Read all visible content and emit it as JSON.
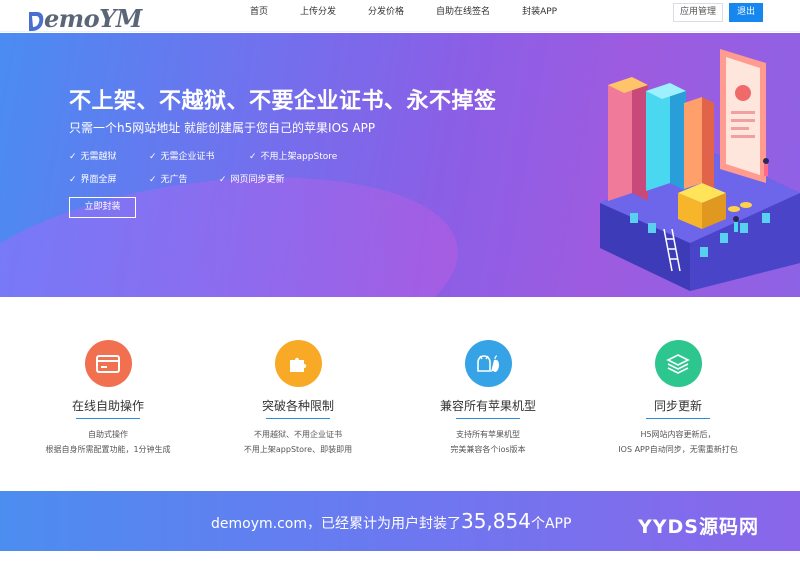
{
  "header": {
    "logo_text": "emoYM",
    "nav": [
      "首页",
      "上传分发",
      "分发价格",
      "自助在线签名",
      "封装APP"
    ],
    "manage_label": "应用管理",
    "logout_label": "退出"
  },
  "hero": {
    "title": "不上架、不越狱、不要企业证书、永不掉签",
    "subtitle": "只需一个h5网站地址 就能创建属于您自己的苹果IOS APP",
    "features": [
      "无需越狱",
      "无需企业证书",
      "不用上架appStore",
      "界面全屏",
      "无广告",
      "网页同步更新"
    ],
    "check_glyph": "✓",
    "button_label": "立即封装"
  },
  "cards": [
    {
      "icon": "card-icon",
      "title": "在线自助操作",
      "lines": [
        "自助式操作",
        "根据自身所需配置功能，1分钟生成"
      ],
      "color": "#f0704f"
    },
    {
      "icon": "puzzle-icon",
      "title": "突破各种限制",
      "lines": [
        "不用越狱、不用企业证书",
        "不用上架appStore、即装即用"
      ],
      "color": "#f8a926"
    },
    {
      "icon": "apple-android-icon",
      "title": "兼容所有苹果机型",
      "lines": [
        "支持所有苹果机型",
        "完美兼容各个ios版本"
      ],
      "color": "#36a3e6"
    },
    {
      "icon": "layers-icon",
      "title": "同步更新",
      "lines": [
        "H5网站内容更新后，",
        "IOS APP自动同步，无需重新打包"
      ],
      "color": "#2ec68f"
    }
  ],
  "band": {
    "prefix": "demoym.com，已经累计为用户封装了",
    "count": "35,854",
    "suffix": "个APP",
    "watermark": "YYDS源码网"
  },
  "colors": {
    "primary": "#1687ee",
    "accent_line": "#2a8fe0"
  }
}
